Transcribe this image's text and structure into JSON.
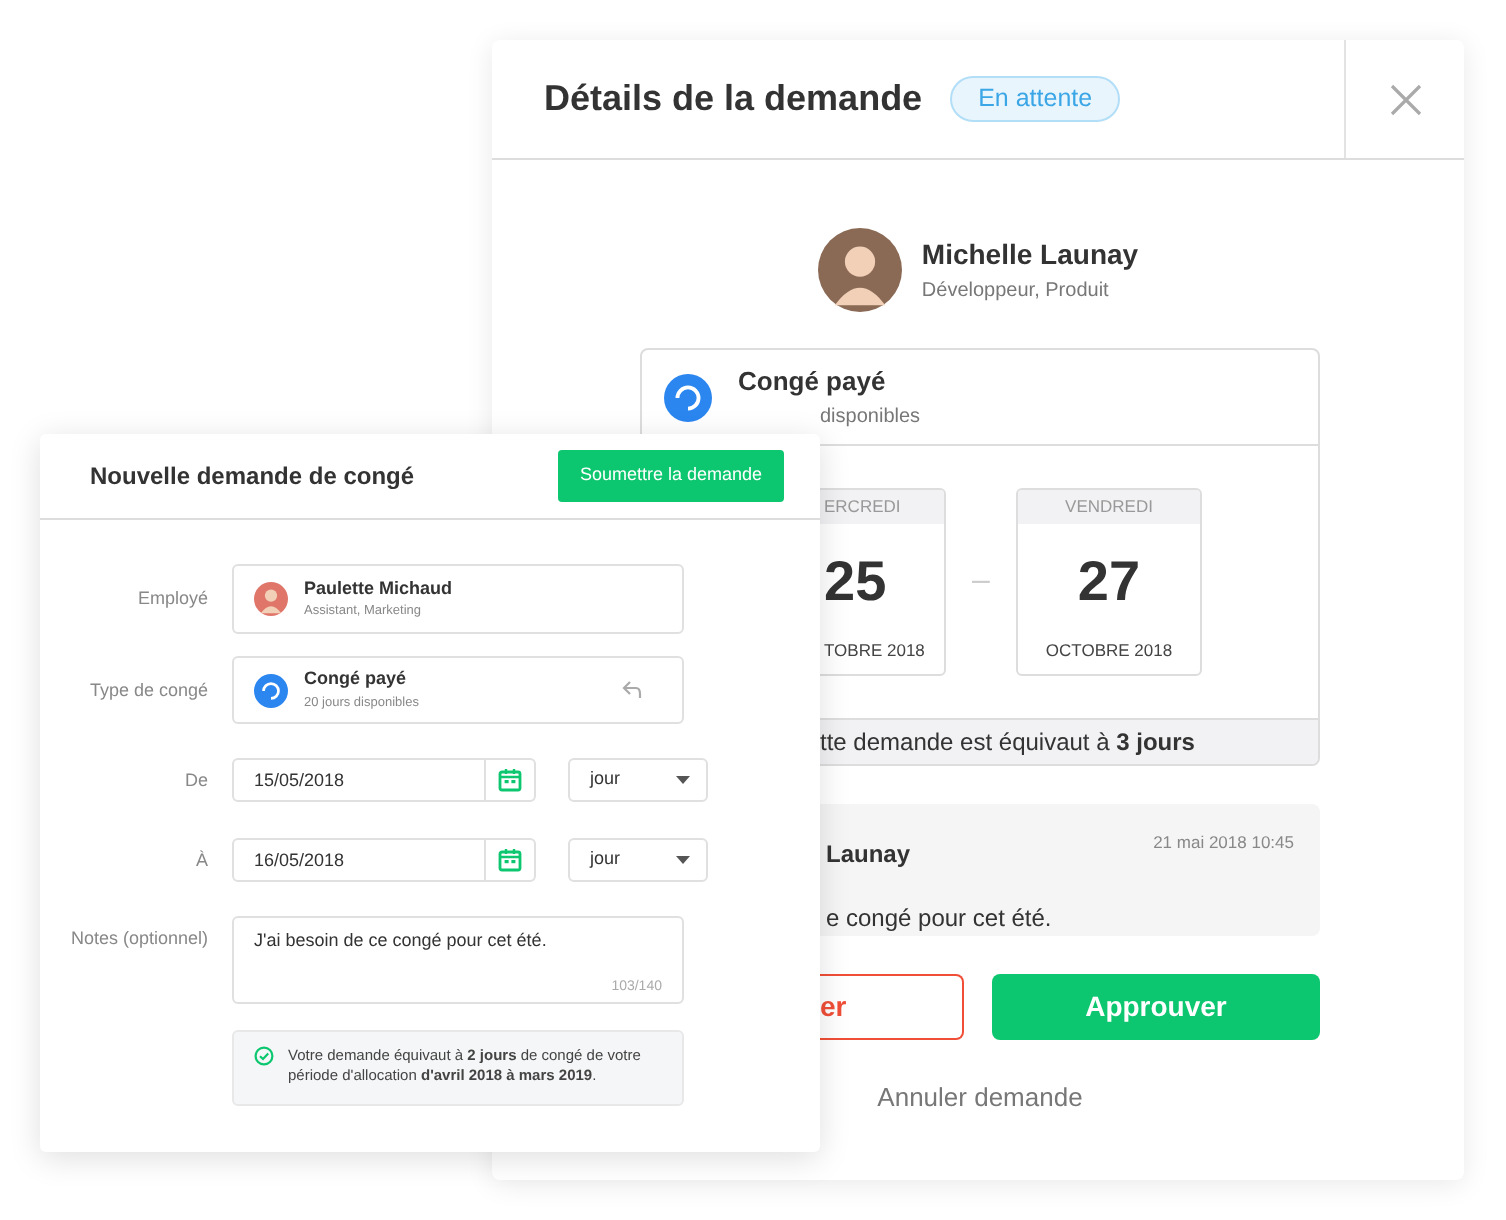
{
  "request_details": {
    "title": "Détails de la demande",
    "status": "En attente",
    "employee": {
      "name": "Michelle Launay",
      "role": "Développeur, Produit"
    },
    "leave_type": {
      "name": "Congé payé",
      "balance": "disponibles"
    },
    "dates": [
      {
        "weekday": "ERCREDI",
        "day": "25",
        "month": "TOBRE 2018"
      },
      {
        "weekday": "VENDREDI",
        "day": "27",
        "month": "OCTOBRE 2018"
      }
    ],
    "separator": "–",
    "summary": "tte demande est équivaut à **3 jours**",
    "comment": {
      "author": "Launay",
      "time": "21 mai 2018 10:45",
      "text": "e congé pour cet été."
    },
    "actions": [
      {
        "label": "er",
        "kind": "reject"
      },
      {
        "label": "Approuver",
        "kind": "approve"
      }
    ],
    "cancel": "Annuler demande"
  },
  "new_request": {
    "title": "Nouvelle demande de congé",
    "submit": "Soumettre la demande",
    "fields": [
      {
        "kind": "person",
        "label": "Employé",
        "name": "Paulette Michaud",
        "role": "Assistant, Marketing"
      },
      {
        "kind": "leave",
        "label": "Type de congé",
        "name": "Congé payé",
        "balance": "20 jours disponibles"
      },
      {
        "kind": "date",
        "label": "De",
        "value": "15/05/2018",
        "unit": "jour"
      },
      {
        "kind": "date",
        "label": "À",
        "value": "16/05/2018",
        "unit": "jour"
      },
      {
        "kind": "notes",
        "label": "Notes (optionnel)",
        "value": "J'ai besoin de ce congé pour cet été.",
        "counter": "103/140"
      }
    ],
    "notice": "Votre demande équivaut à **2 jours** de congé de votre période d'allocation **d'avril 2018 à mars 2019**."
  }
}
